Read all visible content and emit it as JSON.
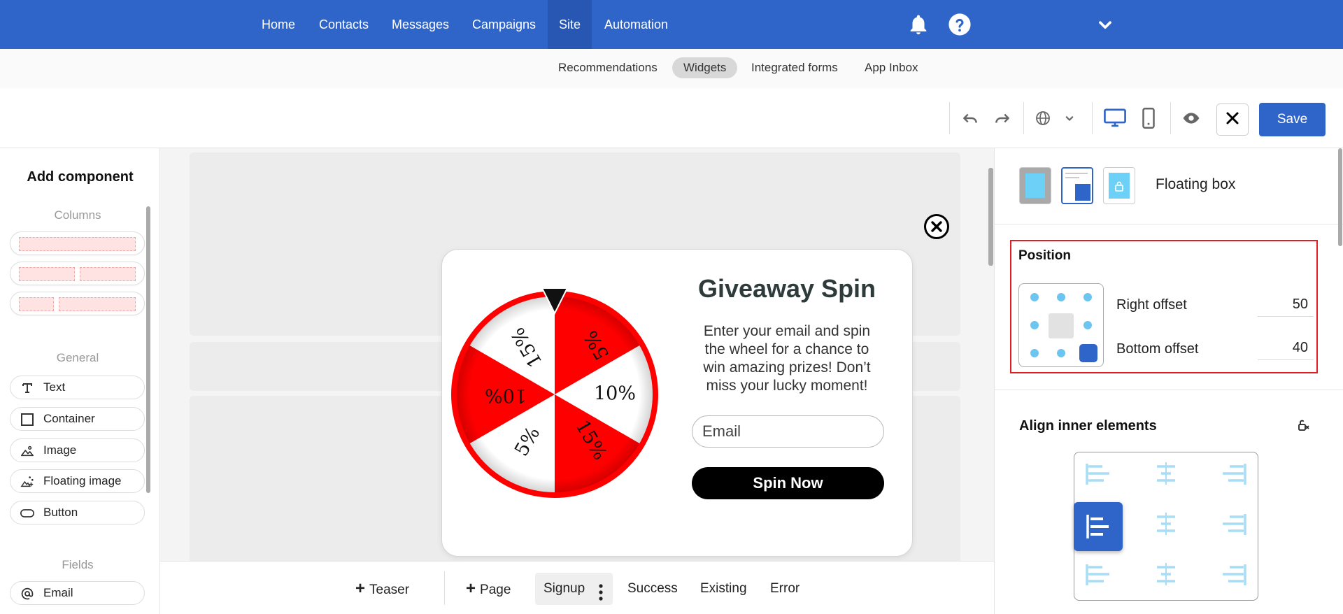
{
  "topnav": {
    "items": [
      {
        "label": "Home"
      },
      {
        "label": "Contacts"
      },
      {
        "label": "Messages"
      },
      {
        "label": "Campaigns"
      },
      {
        "label": "Site",
        "active": true
      },
      {
        "label": "Automation"
      }
    ],
    "icons": [
      "bell-icon",
      "help-icon",
      "chevron-down-icon"
    ]
  },
  "subnav": {
    "items": [
      {
        "label": "Recommendations"
      },
      {
        "label": "Widgets",
        "active": true
      },
      {
        "label": "Integrated forms"
      },
      {
        "label": "App Inbox"
      }
    ]
  },
  "toolbar": {
    "icons": [
      "undo-icon",
      "redo-icon",
      "globe-icon",
      "chevron-down-icon",
      "desktop-icon",
      "mobile-icon",
      "preview-eye-icon",
      "close-icon"
    ],
    "save_label": "Save"
  },
  "left_panel": {
    "title": "Add component",
    "sections": {
      "columns": "Columns",
      "general": "General",
      "fields": "Fields"
    },
    "general_items": [
      {
        "label": "Text",
        "icon": "text-icon"
      },
      {
        "label": "Container",
        "icon": "container-icon"
      },
      {
        "label": "Image",
        "icon": "image-icon"
      },
      {
        "label": "Floating image",
        "icon": "floating-image-icon"
      },
      {
        "label": "Button",
        "icon": "button-icon"
      }
    ],
    "field_items": [
      {
        "label": "Email",
        "icon": "at-icon"
      }
    ]
  },
  "popup": {
    "title": "Giveaway Spin",
    "text_lines": [
      "Enter your email and spin",
      "the wheel for a chance to",
      "win amazing prizes! Don’t",
      "miss your lucky moment!"
    ],
    "email_placeholder": "Email",
    "button_label": "Spin Now",
    "wheel_slices": [
      "5%",
      "10%",
      "15%",
      "5%",
      "10%",
      "15%"
    ],
    "colors": {
      "red": "#ff0000",
      "white": "#ffffff"
    }
  },
  "bottombar": {
    "add_teaser": "Teaser",
    "add_page": "Page",
    "tabs": [
      {
        "label": "Signup",
        "active": true
      },
      {
        "label": "Success"
      },
      {
        "label": "Existing"
      },
      {
        "label": "Error"
      }
    ]
  },
  "right_panel": {
    "layout_label": "Floating box",
    "position": {
      "title": "Position",
      "right_offset_label": "Right offset",
      "right_offset_value": "50",
      "bottom_offset_label": "Bottom offset",
      "bottom_offset_value": "40"
    },
    "align_title": "Align inner elements"
  },
  "colors": {
    "brand": "#2f64c9",
    "highlight": "#e02020"
  }
}
